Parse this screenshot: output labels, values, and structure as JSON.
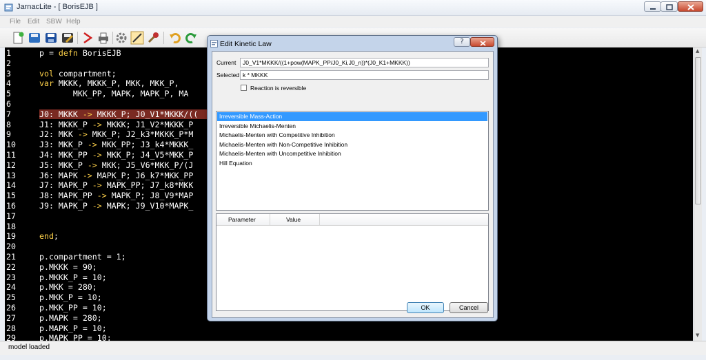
{
  "window": {
    "title": "JarnacLite - [ BorisEJB ]"
  },
  "menus": [
    "File",
    "Edit",
    "SBW",
    "Help"
  ],
  "toolbar": [
    "new-icon",
    "open-icon",
    "save-icon",
    "save-as-icon",
    "run-icon",
    "print-icon",
    "settings-icon",
    "edit-icon",
    "tools-icon",
    "undo-icon",
    "redo-icon"
  ],
  "editor": {
    "lines": [
      {
        "n": "1",
        "t": "p = defn BorisEJB"
      },
      {
        "n": "2",
        "t": ""
      },
      {
        "n": "3",
        "t": "vol compartment;"
      },
      {
        "n": "4",
        "t": "var MKKK, MKKK_P, MKK, MKK_P,"
      },
      {
        "n": "5",
        "t": "       MKK_PP, MAPK, MAPK_P, MA"
      },
      {
        "n": "6",
        "t": ""
      },
      {
        "n": "7",
        "t": "J0: MKKK -> MKKK_P; J0_V1*MKKK/(("
      },
      {
        "n": "8",
        "t": "J1: MKKK_P -> MKKK; J1_V2*MKKK_P"
      },
      {
        "n": "9",
        "t": "J2: MKK -> MKK_P; J2_k3*MKKK_P*M"
      },
      {
        "n": "10",
        "t": "J3: MKK_P -> MKK_PP; J3_k4*MKKK_"
      },
      {
        "n": "11",
        "t": "J4: MKK_PP -> MKK_P; J4_V5*MKK_P"
      },
      {
        "n": "12",
        "t": "J5: MKK_P -> MKK; J5_V6*MKK_P/(J"
      },
      {
        "n": "13",
        "t": "J6: MAPK -> MAPK_P; J6_k7*MKK_PP"
      },
      {
        "n": "14",
        "t": "J7: MAPK_P -> MAPK_PP; J7_k8*MKK"
      },
      {
        "n": "15",
        "t": "J8: MAPK_PP -> MAPK_P; J8_V9*MAP"
      },
      {
        "n": "16",
        "t": "J9: MAPK_P -> MAPK; J9_V10*MAPK_"
      },
      {
        "n": "17",
        "t": ""
      },
      {
        "n": "18",
        "t": ""
      },
      {
        "n": "19",
        "t": "end;"
      },
      {
        "n": "20",
        "t": ""
      },
      {
        "n": "21",
        "t": "p.compartment = 1;"
      },
      {
        "n": "22",
        "t": "p.MKKK = 90;"
      },
      {
        "n": "23",
        "t": "p.MKKK_P = 10;"
      },
      {
        "n": "24",
        "t": "p.MKK = 280;"
      },
      {
        "n": "25",
        "t": "p.MKK_P = 10;"
      },
      {
        "n": "26",
        "t": "p.MKK_PP = 10;"
      },
      {
        "n": "27",
        "t": "p.MAPK = 280;"
      },
      {
        "n": "28",
        "t": "p.MAPK_P = 10;"
      },
      {
        "n": "29",
        "t": "p.MAPK_PP = 10;"
      }
    ]
  },
  "status": {
    "text": "model loaded"
  },
  "dialog": {
    "title": "Edit Kinetic Law",
    "help": "?",
    "current_label": "Current",
    "current_value": "J0_V1*MKKK/((1+pow(MAPK_PP/J0_Ki,J0_n))*(J0_K1+MKKK))",
    "selected_label": "Selected",
    "selected_value": "k * MKKK",
    "reversible_label": "Reaction is reversible",
    "laws": [
      "Irreversible Mass-Action",
      "Irreversible Michaelis-Menten",
      "Michaelis-Menten with Competitive Inhibition",
      "Michaelis-Menten with Non-Competitive Inhibition",
      "Michaelis-Menten with Uncompetitive Inhibition",
      "Hill Equation"
    ],
    "table_headers": [
      "Parameter",
      "Value"
    ],
    "ok": "OK",
    "cancel": "Cancel"
  },
  "colors": {
    "editor_bg": "#000000",
    "keyword": "#ffd24a",
    "highlight": "#7a2a22",
    "selection": "#3399ff"
  }
}
